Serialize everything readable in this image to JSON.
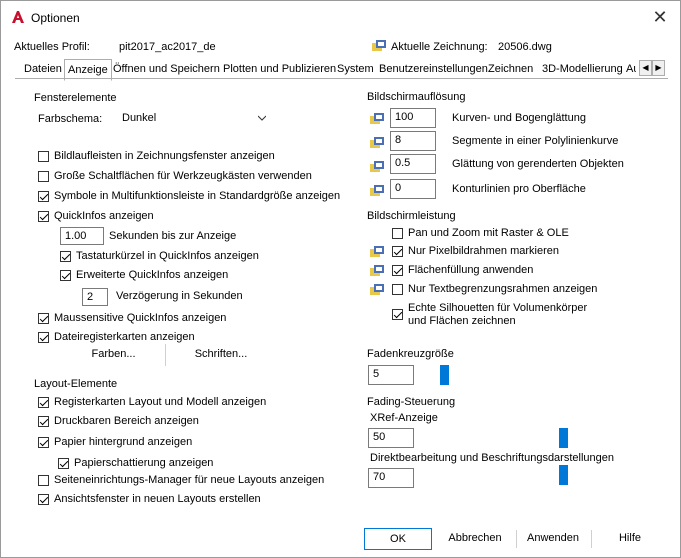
{
  "window": {
    "title": "Optionen"
  },
  "profile": {
    "label": "Aktuelles Profil:",
    "value": "pit2017_ac2017_de",
    "drawing_label": "Aktuelle Zeichnung:",
    "drawing_value": "20506.dwg"
  },
  "tabs": [
    "Dateien",
    "Anzeige",
    "Öffnen und Speichern",
    "Plotten und Publizieren",
    "System",
    "Benutzereinstellungen",
    "Zeichnen",
    "3D-Modellierung",
    "Au"
  ],
  "window_elements": {
    "heading": "Fensterelemente",
    "color_scheme_label": "Farbschema:",
    "color_scheme_value": "Dunkel",
    "checks": [
      {
        "label": "Bildlaufleisten in Zeichnungsfenster anzeigen",
        "checked": false
      },
      {
        "label": "Große Schaltflächen für Werkzeugkästen verwenden",
        "checked": false
      },
      {
        "label": "Symbole in Multifunktionsleiste in Standardgröße anzeigen",
        "checked": true
      },
      {
        "label": "QuickInfos anzeigen",
        "checked": true
      }
    ],
    "seconds_value": "1.00",
    "seconds_label": "Sekunden bis zur Anzeige",
    "shortcut_label": "Tastaturkürzel in QuickInfos anzeigen",
    "shortcut_checked": true,
    "extended_label": "Erweiterte QuickInfos anzeigen",
    "extended_checked": true,
    "delay_value": "2",
    "delay_label": "Verzögerung in Sekunden",
    "mouse_label": "Maussensitive QuickInfos anzeigen",
    "mouse_checked": true,
    "filetabs_label": "Dateiregisterkarten anzeigen",
    "filetabs_checked": true,
    "colors_button": "Farben...",
    "fonts_button": "Schriften..."
  },
  "layout_elements": {
    "heading": "Layout-Elemente",
    "checks": [
      {
        "label": "Registerkarten Layout und Modell anzeigen",
        "checked": true
      },
      {
        "label": "Druckbaren Bereich anzeigen",
        "checked": true
      },
      {
        "label": "Papier hintergrund anzeigen",
        "checked": true
      }
    ],
    "shadow_label": "Papierschattierung anzeigen",
    "shadow_checked": true,
    "checks2": [
      {
        "label": "Seiteneinrichtungs-Manager für neue Layouts anzeigen",
        "checked": false
      },
      {
        "label": "Ansichtsfenster in neuen Layouts erstellen",
        "checked": true
      }
    ]
  },
  "resolution": {
    "heading": "Bildschirmauflösung",
    "rows": [
      {
        "value": "100",
        "label": "Kurven- und Bogenglättung"
      },
      {
        "value": "8",
        "label": "Segmente in einer Polylinienkurve"
      },
      {
        "value": "0.5",
        "label": "Glättung von gerenderten Objekten"
      },
      {
        "value": "0",
        "label": "Konturlinien pro Oberfläche"
      }
    ]
  },
  "performance": {
    "heading": "Bildschirmleistung",
    "checks": [
      {
        "label": "Pan und Zoom mit Raster & OLE",
        "checked": false,
        "icon": false
      },
      {
        "label": "Nur Pixelbildrahmen markieren",
        "checked": true,
        "icon": true
      },
      {
        "label": "Flächenfüllung anwenden",
        "checked": true,
        "icon": true
      },
      {
        "label": "Nur Textbegrenzungsrahmen anzeigen",
        "checked": false,
        "icon": true
      }
    ],
    "silhouette_line1": "Echte Silhouetten für Volumenkörper",
    "silhouette_line2": "und Flächen zeichnen",
    "silhouette_checked": true
  },
  "crosshair": {
    "heading": "Fadenkreuzgröße",
    "value": "5",
    "level": 5
  },
  "fading": {
    "heading": "Fading-Steuerung",
    "xref_label": "XRef-Anzeige",
    "xref_value": "50",
    "inplace_label": "Direktbearbeitung und Beschriftungsdarstellungen",
    "inplace_value": "70"
  },
  "buttons": {
    "ok": "OK",
    "cancel": "Abbrechen",
    "apply": "Anwenden",
    "help": "Hilfe"
  },
  "colors": {
    "accent": "#0078d7",
    "brand": "#c8102e"
  }
}
